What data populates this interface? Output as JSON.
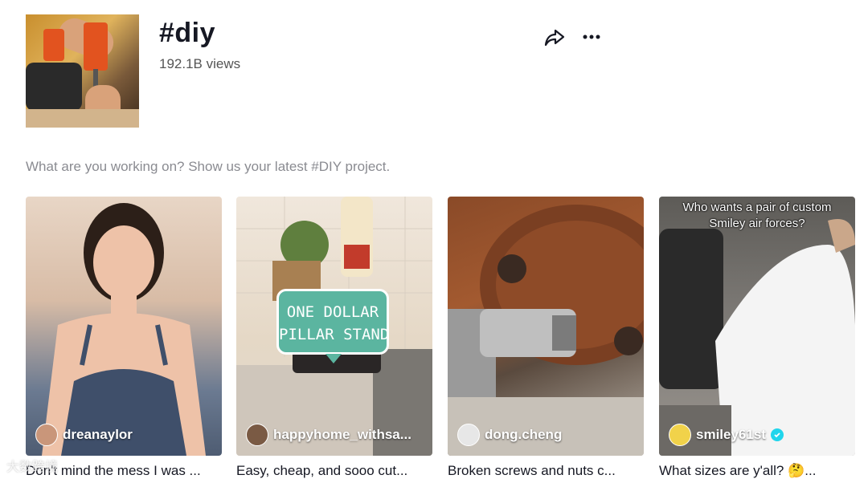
{
  "hashtag": {
    "title": "#diy",
    "views": "192.1B views",
    "description": "What are you working on? Show us your latest #DIY project."
  },
  "actions": {
    "share_icon": "share-arrow-icon",
    "more_icon": "more-horizontal-icon"
  },
  "videos": [
    {
      "author": "dreanaylor",
      "caption": "Don't mind the mess I was ...",
      "verified": false
    },
    {
      "author": "happyhome_withsa...",
      "caption": "Easy, cheap, and sooo cut...",
      "overlay": "ONE DOLLAR\nPILLAR STAND",
      "verified": false
    },
    {
      "author": "dong.cheng",
      "caption": "Broken screws and nuts c...",
      "verified": false
    },
    {
      "author": "smiley61st",
      "caption": "What sizes are y'all? 🤔...",
      "overlay": "Who wants a pair of custom\nSmiley air forces?",
      "verified": true
    }
  ],
  "watermark": "大数跨境",
  "colors": {
    "verified": "#20d5ec",
    "speech_bubble": "#5bb5a0"
  }
}
